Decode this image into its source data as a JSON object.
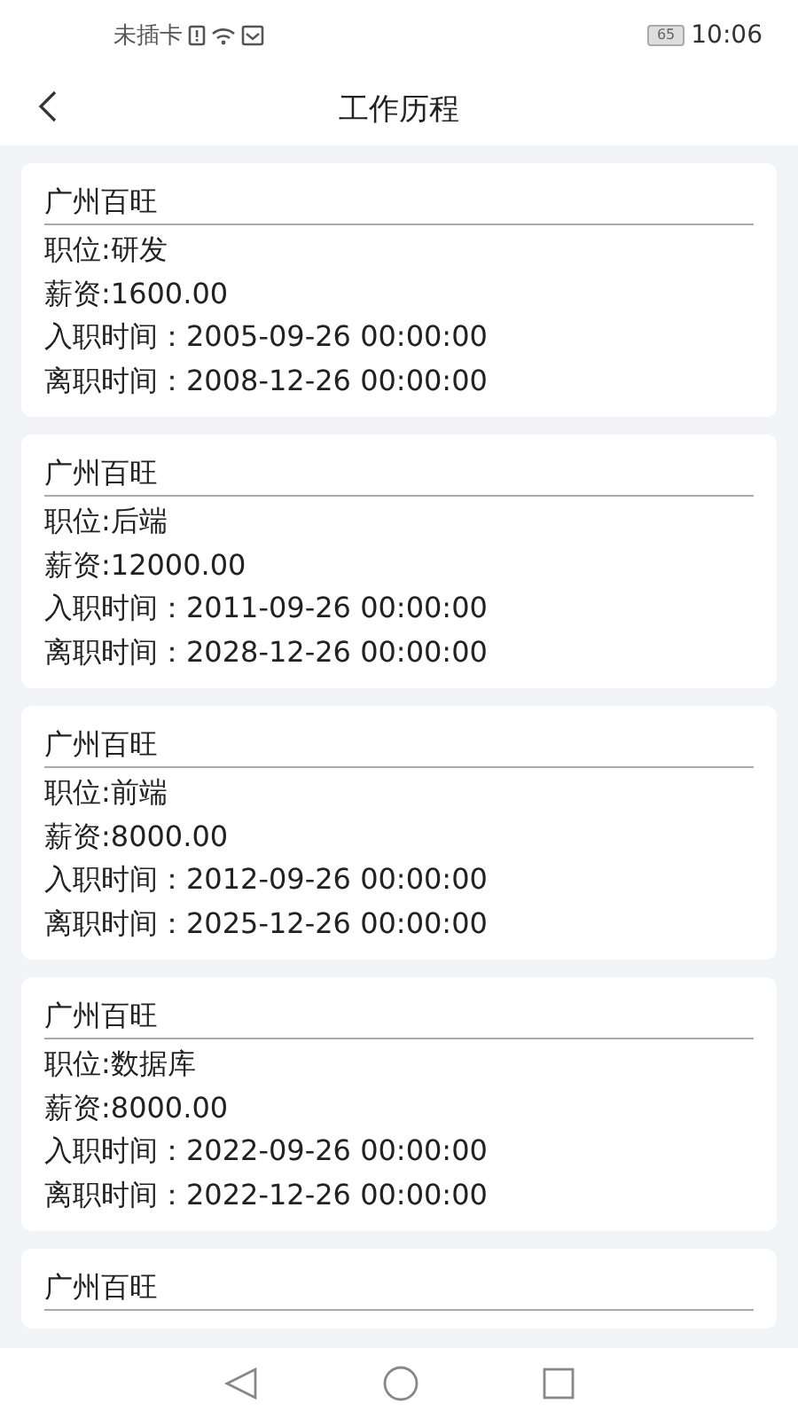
{
  "status_bar": {
    "carrier": "未插卡",
    "battery": "65",
    "time": "10:06"
  },
  "header": {
    "title": "工作历程"
  },
  "records": [
    {
      "company": "广州百旺",
      "lines": [
        "职位:研发",
        "薪资:1600.00",
        "入职时间：2005-09-26 00:00:00",
        "离职时间：2008-12-26 00:00:00"
      ]
    },
    {
      "company": "广州百旺",
      "lines": [
        "职位:后端",
        "薪资:12000.00",
        "入职时间：2011-09-26 00:00:00",
        "离职时间：2028-12-26 00:00:00"
      ]
    },
    {
      "company": "广州百旺",
      "lines": [
        "职位:前端",
        "薪资:8000.00",
        "入职时间：2012-09-26 00:00:00",
        "离职时间：2025-12-26 00:00:00"
      ]
    },
    {
      "company": "广州百旺",
      "lines": [
        "职位:数据库",
        "薪资:8000.00",
        "入职时间：2022-09-26 00:00:00",
        "离职时间：2022-12-26 00:00:00"
      ]
    },
    {
      "company": "广州百旺"
    }
  ]
}
